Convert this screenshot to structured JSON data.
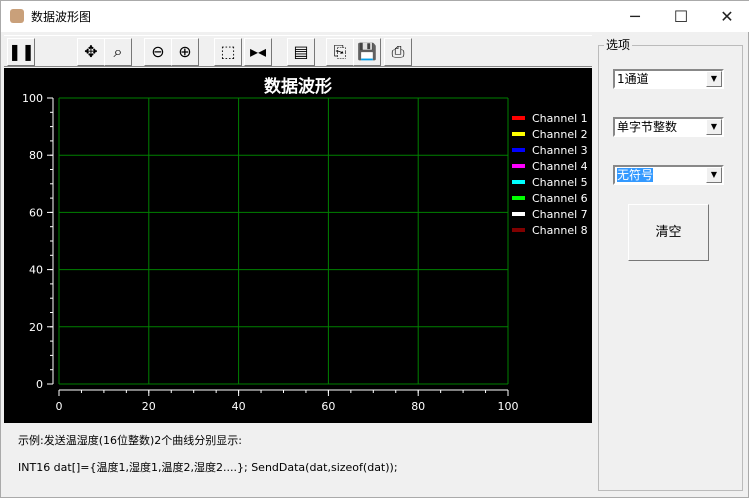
{
  "window": {
    "title": "数据波形图",
    "minimize": "─",
    "maximize": "☐",
    "close": "✕"
  },
  "toolbar": {
    "buttons": [
      {
        "name": "pause",
        "glyph": "❚❚"
      },
      {
        "name": "move",
        "glyph": "✥"
      },
      {
        "name": "zoom-region",
        "glyph": "⌕"
      },
      {
        "name": "zoom-out",
        "glyph": "⊖"
      },
      {
        "name": "zoom-in",
        "glyph": "⊕"
      },
      {
        "name": "select",
        "glyph": "⬚"
      },
      {
        "name": "cursor",
        "glyph": "▸◂"
      },
      {
        "name": "properties",
        "glyph": "▤"
      },
      {
        "name": "copy",
        "glyph": "⎘"
      },
      {
        "name": "save",
        "glyph": "💾"
      },
      {
        "name": "print",
        "glyph": "⎙"
      }
    ]
  },
  "chart_data": {
    "type": "line",
    "title": "数据波形",
    "xlim": [
      0,
      100
    ],
    "ylim": [
      0,
      100
    ],
    "xticks": [
      "0",
      "20",
      "40",
      "60",
      "80",
      "100"
    ],
    "yticks": [
      "0",
      "20",
      "40",
      "60",
      "80",
      "100"
    ],
    "grid": true,
    "legend_position": "right",
    "series": [
      {
        "name": "Channel 1",
        "color": "#ff0000",
        "values": []
      },
      {
        "name": "Channel 2",
        "color": "#ffff00",
        "values": []
      },
      {
        "name": "Channel 3",
        "color": "#0000ff",
        "values": []
      },
      {
        "name": "Channel 4",
        "color": "#ff00ff",
        "values": []
      },
      {
        "name": "Channel 5",
        "color": "#00ffff",
        "values": []
      },
      {
        "name": "Channel 6",
        "color": "#00ff00",
        "values": []
      },
      {
        "name": "Channel 7",
        "color": "#ffffff",
        "values": []
      },
      {
        "name": "Channel 8",
        "color": "#800000",
        "values": []
      }
    ]
  },
  "notes": {
    "line1": "示例:发送温湿度(16位整数)2个曲线分别显示:",
    "line2": "INT16 dat[]={温度1,湿度1,温度2,湿度2....}; SendData(dat,sizeof(dat));"
  },
  "options": {
    "label": "选项",
    "channel": "1通道",
    "data_type": "单字节整数",
    "sign": "无符号",
    "clear": "清空"
  }
}
